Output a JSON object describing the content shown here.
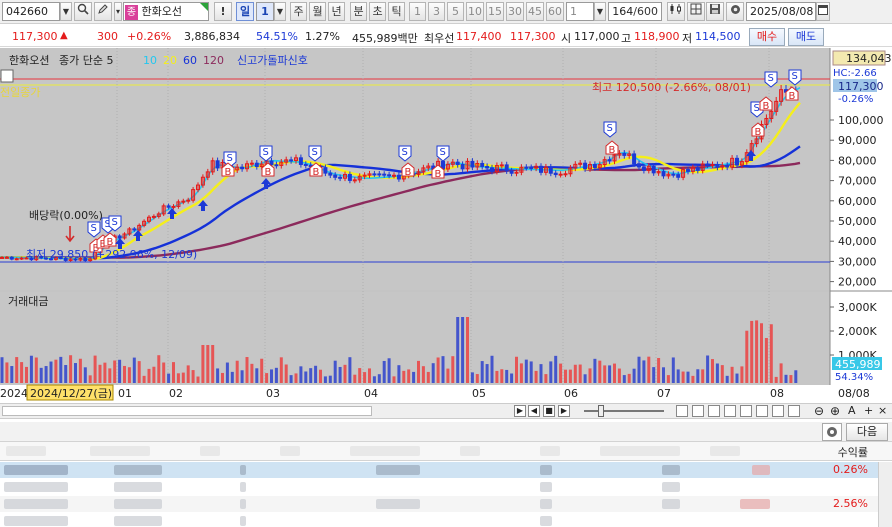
{
  "toolbar": {
    "code": "042660",
    "name": "한화오선",
    "name_tag": "종",
    "period_buttons": [
      "일",
      "주",
      "월",
      "년",
      "분",
      "초",
      "틱"
    ],
    "period_count": "1",
    "tick_buttons": [
      "1",
      "3",
      "5",
      "10",
      "15",
      "30",
      "45",
      "60"
    ],
    "interval_value": "1",
    "bar_count": "164",
    "bar_total": "/600",
    "date": "2025/08/08",
    "exclaim": "!"
  },
  "quote": {
    "price": "117,300",
    "arrow": "▲",
    "change": "300",
    "change_pct": "+0.26%",
    "volume": "3,886,834",
    "ratio": "54.51%",
    "turnover_rate": "1.27%",
    "trade_value": "455,989백만",
    "bid_label": "최우선",
    "bid": "117,400",
    "ask": "117,300",
    "open_label": "시",
    "open": "117,000",
    "high_label": "고",
    "high": "118,900",
    "low_label": "저",
    "low": "114,500",
    "buy_button": "매수",
    "sell_button": "매도"
  },
  "legend": {
    "name": "한화오션",
    "ma_label": "종가 단순 5",
    "ma10": "10",
    "ma20": "20",
    "ma60": "60",
    "ma120": "120",
    "signal": "신고가돌파신호",
    "prev_close": "전일종가",
    "volume_panel": "거래대금"
  },
  "annotations": {
    "high_note": "최고 120,500 (-2.66%, 08/01)",
    "dividend": "배당락(0.00%)",
    "low_note": "최저 29,850 (+292.96%, 12/09)",
    "right_top_box": "134,043",
    "hc": "HC:-2.66",
    "current": "117,300",
    "current_pct": "-0.26%",
    "vol_current": "455,989",
    "vol_pct": "54.34%",
    "cursor_date": "2024/12/27(금)",
    "start_year": "2024",
    "end_date": "08/08"
  },
  "price_axis": [
    "100,000",
    "90,000",
    "80,000",
    "70,000",
    "60,000",
    "50,000",
    "40,000",
    "30,000",
    "20,000"
  ],
  "volume_axis": [
    "3,000K",
    "2,000K",
    "1,000K"
  ],
  "x_months": [
    "01",
    "02",
    "03",
    "04",
    "05",
    "06",
    "07",
    "08"
  ],
  "colors": {
    "up": "#e41b1b",
    "down": "#1c39d6",
    "ma5": "#22c7f0",
    "ma20": "#f5ef1a",
    "ma60": "#1531d8",
    "ma120": "#8c2a5c",
    "chart_bg": "#c6c6c6"
  },
  "bottom": {
    "next_button": "다음",
    "header": "수익률",
    "rows": [
      "0.26%",
      "",
      "2.56%"
    ]
  }
}
